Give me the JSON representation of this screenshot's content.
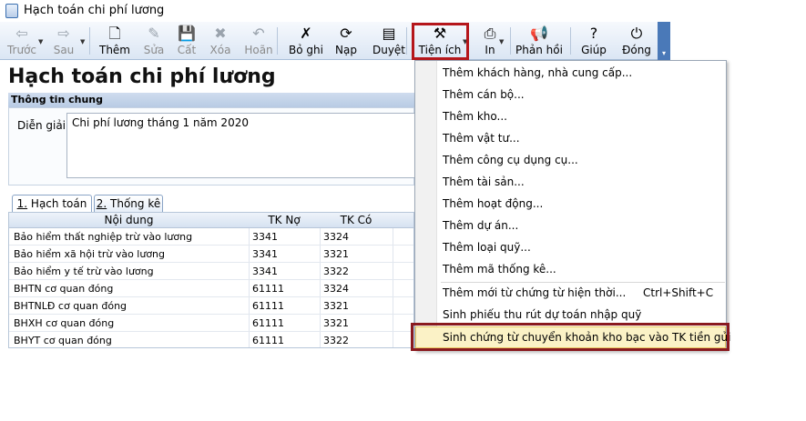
{
  "window": {
    "title": "Hạch toán chi phí lương"
  },
  "toolbar": {
    "items": [
      {
        "label": "Trước",
        "icon": "arrow-left-icon",
        "glyph": "⇦",
        "disabled": true
      },
      {
        "label": "Sau",
        "icon": "arrow-right-icon",
        "glyph": "⇨",
        "disabled": true
      },
      {
        "label": "Thêm",
        "icon": "add-document-icon",
        "glyph": "🗋",
        "disabled": false
      },
      {
        "label": "Sửa",
        "icon": "edit-icon",
        "glyph": "✎",
        "disabled": true
      },
      {
        "label": "Cất",
        "icon": "save-icon",
        "glyph": "💾",
        "disabled": true
      },
      {
        "label": "Xóa",
        "icon": "delete-icon",
        "glyph": "✖",
        "disabled": true
      },
      {
        "label": "Hoãn",
        "icon": "undo-icon",
        "glyph": "↶",
        "disabled": true
      },
      {
        "label": "Bỏ ghi",
        "icon": "unpost-icon",
        "glyph": "✗",
        "disabled": false
      },
      {
        "label": "Nạp",
        "icon": "reload-icon",
        "glyph": "⟳",
        "disabled": false
      },
      {
        "label": "Duyệt",
        "icon": "browse-icon",
        "glyph": "▤",
        "disabled": false
      },
      {
        "label": "Tiện ích",
        "icon": "tools-icon",
        "glyph": "⚒",
        "disabled": false
      },
      {
        "label": "In",
        "icon": "print-icon",
        "glyph": "⎙",
        "disabled": false
      },
      {
        "label": "Phản hồi",
        "icon": "megaphone-icon",
        "glyph": "📢",
        "disabled": false
      },
      {
        "label": "Giúp",
        "icon": "help-icon",
        "glyph": "?",
        "disabled": false
      },
      {
        "label": "Đóng",
        "icon": "close-icon",
        "glyph": "⏻",
        "disabled": false
      }
    ]
  },
  "page": {
    "title": "Hạch toán chi phí lương"
  },
  "general": {
    "section_title": "Thông tin chung",
    "description_label": "Diễn giải",
    "description_value": "Chi phí lương tháng 1 năm 2020"
  },
  "tabs": [
    {
      "num": "1.",
      "label": " Hạch toán"
    },
    {
      "num": "2.",
      "label": " Thống kê"
    }
  ],
  "grid": {
    "columns": [
      "Nội dung",
      "TK Nợ",
      "TK Có"
    ],
    "rows": [
      [
        "Bảo hiểm thất nghiệp trừ vào lương",
        "3341",
        "3324"
      ],
      [
        "Bảo hiểm xã hội trừ vào lương",
        "3341",
        "3321"
      ],
      [
        "Bảo hiểm y tế trừ vào lương",
        "3341",
        "3322"
      ],
      [
        "BHTN cơ quan đóng",
        "61111",
        "3324"
      ],
      [
        "BHTNLĐ cơ quan đóng",
        "61111",
        "3321"
      ],
      [
        "BHXH cơ quan đóng",
        "61111",
        "3321"
      ],
      [
        "BHYT cơ quan đóng",
        "61111",
        "3322"
      ]
    ]
  },
  "menu": {
    "items": [
      "Thêm khách hàng, nhà cung cấp...",
      "Thêm cán bộ...",
      "Thêm kho...",
      "Thêm vật tư...",
      "Thêm công cụ dụng cụ...",
      "Thêm tài sản...",
      "Thêm hoạt động...",
      "Thêm dự án...",
      "Thêm loại quỹ...",
      "Thêm mã thống kê..."
    ],
    "item_from_voucher": "Thêm mới từ chứng từ hiện thời...",
    "item_from_voucher_shortcut": "Ctrl+Shift+C",
    "item_receipt": "Sinh phiếu thu rút dự toán nhập quỹ",
    "item_transfer": "Sinh chứng từ chuyển khoản kho bạc vào TK tiền gửi"
  }
}
